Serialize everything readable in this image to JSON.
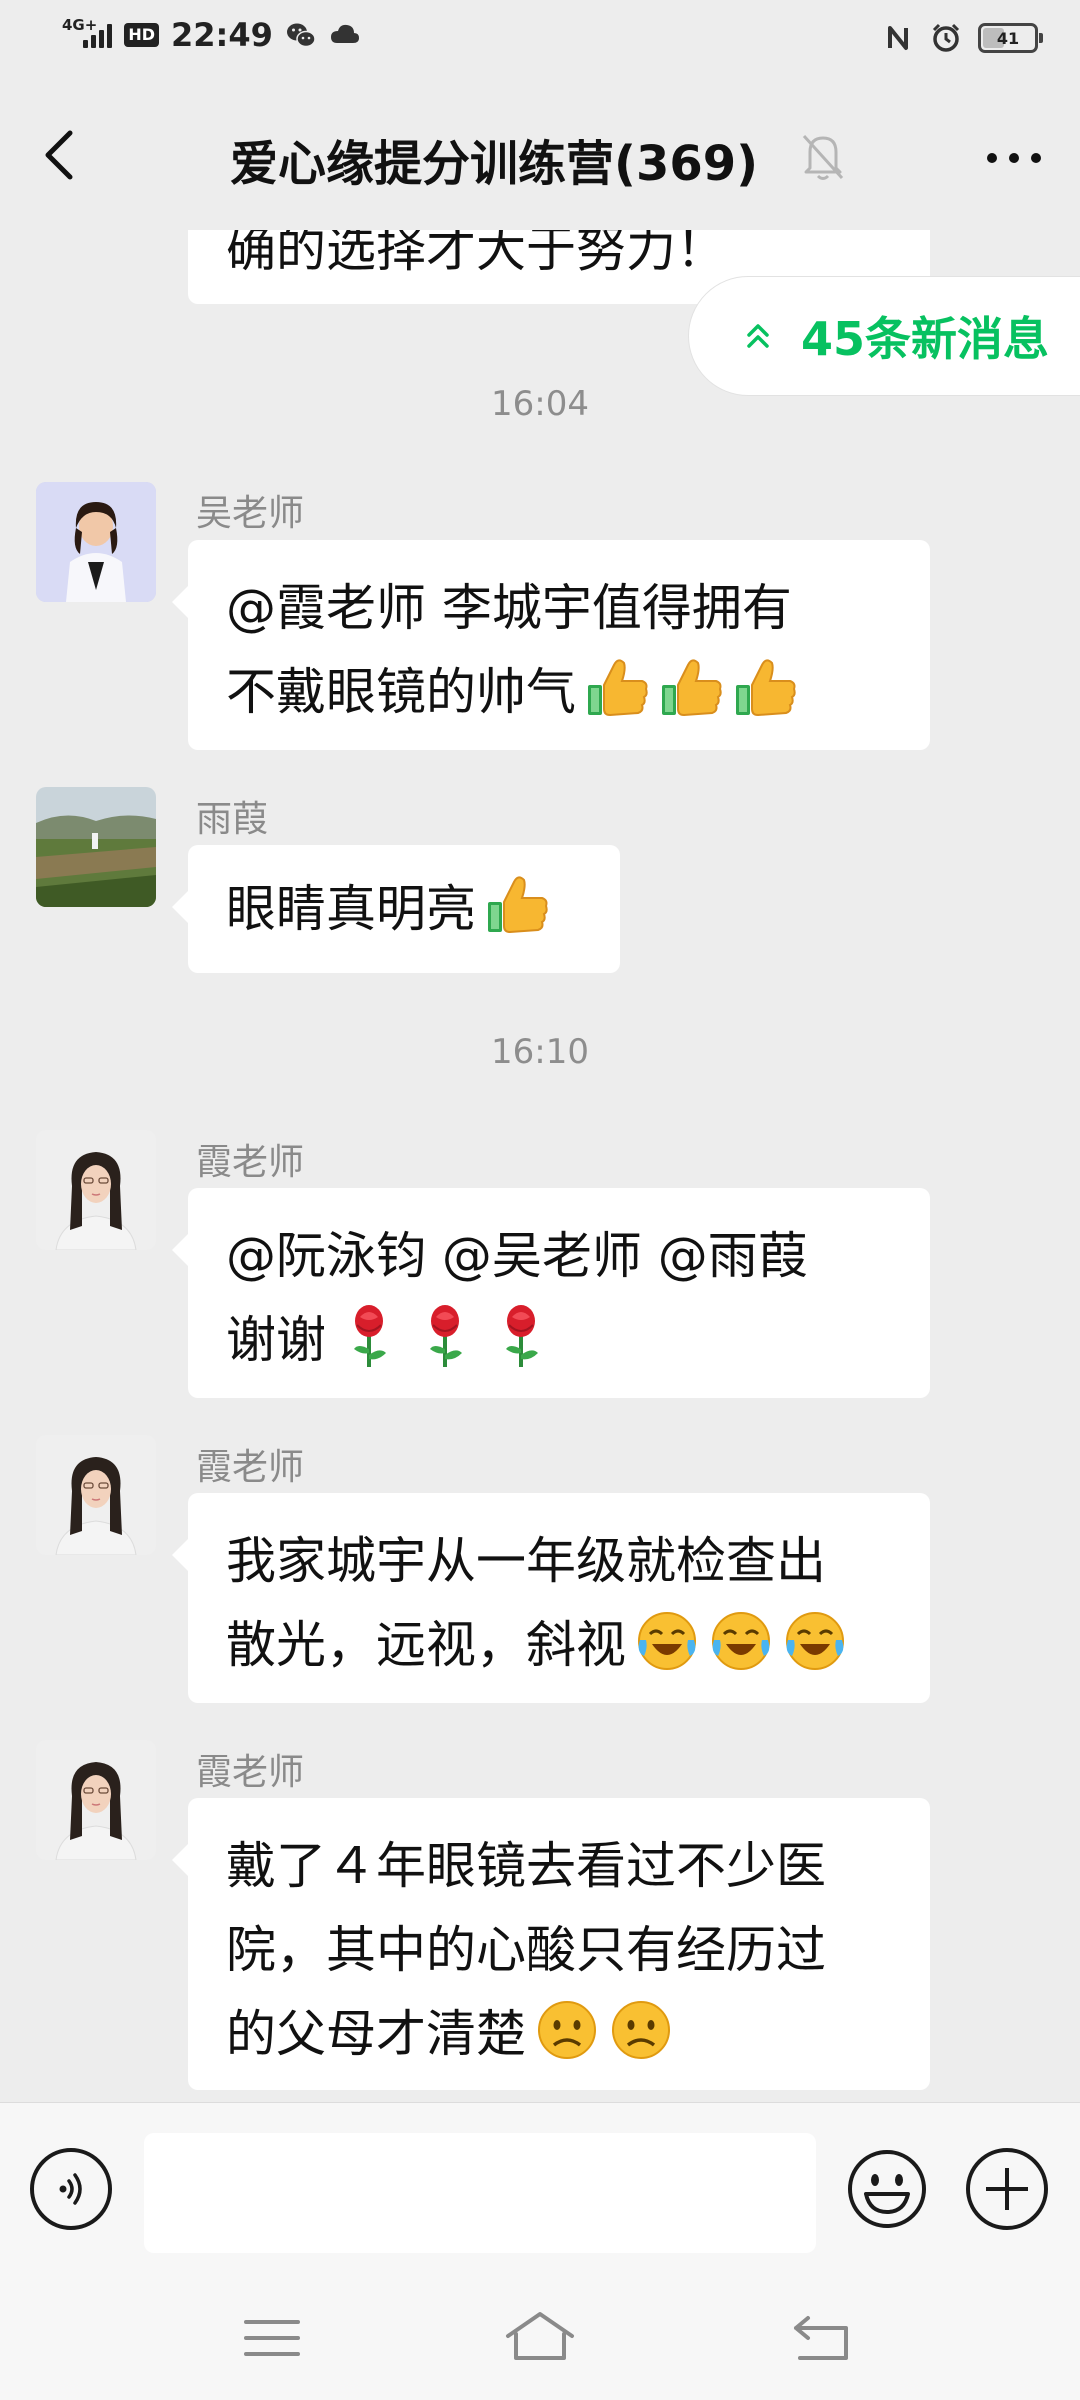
{
  "status_bar": {
    "network": "4G+",
    "hd": "HD",
    "time": "22:49",
    "battery": "41",
    "battery_level_percent": 41,
    "icons": [
      "signal-icon",
      "wechat-icon",
      "cloud-icon",
      "nfc-icon",
      "alarm-icon",
      "battery-icon"
    ]
  },
  "header": {
    "title": "爱心缘提分训练营(369)",
    "icons": [
      "back-arrow-icon",
      "mute-bell-icon",
      "more-dots-icon"
    ]
  },
  "chat": {
    "partial_message": "确的选择才大于努力！",
    "new_messages_label": "45条新消息",
    "groups": [
      {
        "time": "16:04",
        "messages": [
          {
            "sender": "吴老师",
            "text_lines": [
              "@霞老师  李城宇值得拥有",
              "不戴眼镜的帅气"
            ],
            "emoji": [
              "thumbs-up-emoji",
              "thumbs-up-emoji",
              "thumbs-up-emoji"
            ]
          },
          {
            "sender": "雨葭",
            "text_lines": [
              "眼睛真明亮"
            ],
            "emoji": [
              "thumbs-up-emoji"
            ]
          }
        ]
      },
      {
        "time": "16:10",
        "messages": [
          {
            "sender": "霞老师",
            "text_lines": [
              "@阮泳钧  @吴老师  @雨葭",
              "谢谢"
            ],
            "emoji": [
              "rose-emoji",
              "rose-emoji",
              "rose-emoji"
            ]
          },
          {
            "sender": "霞老师",
            "text_lines": [
              "我家城宇从一年级就检查出",
              "散光，远视，斜视"
            ],
            "emoji": [
              "crying-laughing-emoji",
              "crying-laughing-emoji",
              "crying-laughing-emoji"
            ]
          },
          {
            "sender": "霞老师",
            "text_lines": [
              "戴了４年眼镜去看过不少医",
              "院，其中的心酸只有经历过",
              "的父母才清楚"
            ],
            "emoji": [
              "sad-face-emoji",
              "sad-face-emoji"
            ]
          }
        ]
      }
    ]
  },
  "input_bar": {
    "value": "",
    "icons": [
      "voice-icon",
      "emoji-icon",
      "plus-icon"
    ]
  },
  "nav_bar": {
    "icons": [
      "menu-icon",
      "home-icon",
      "back-icon"
    ]
  },
  "colors": {
    "accent": "#07c160",
    "background": "#ededed",
    "bubble": "#ffffff"
  }
}
